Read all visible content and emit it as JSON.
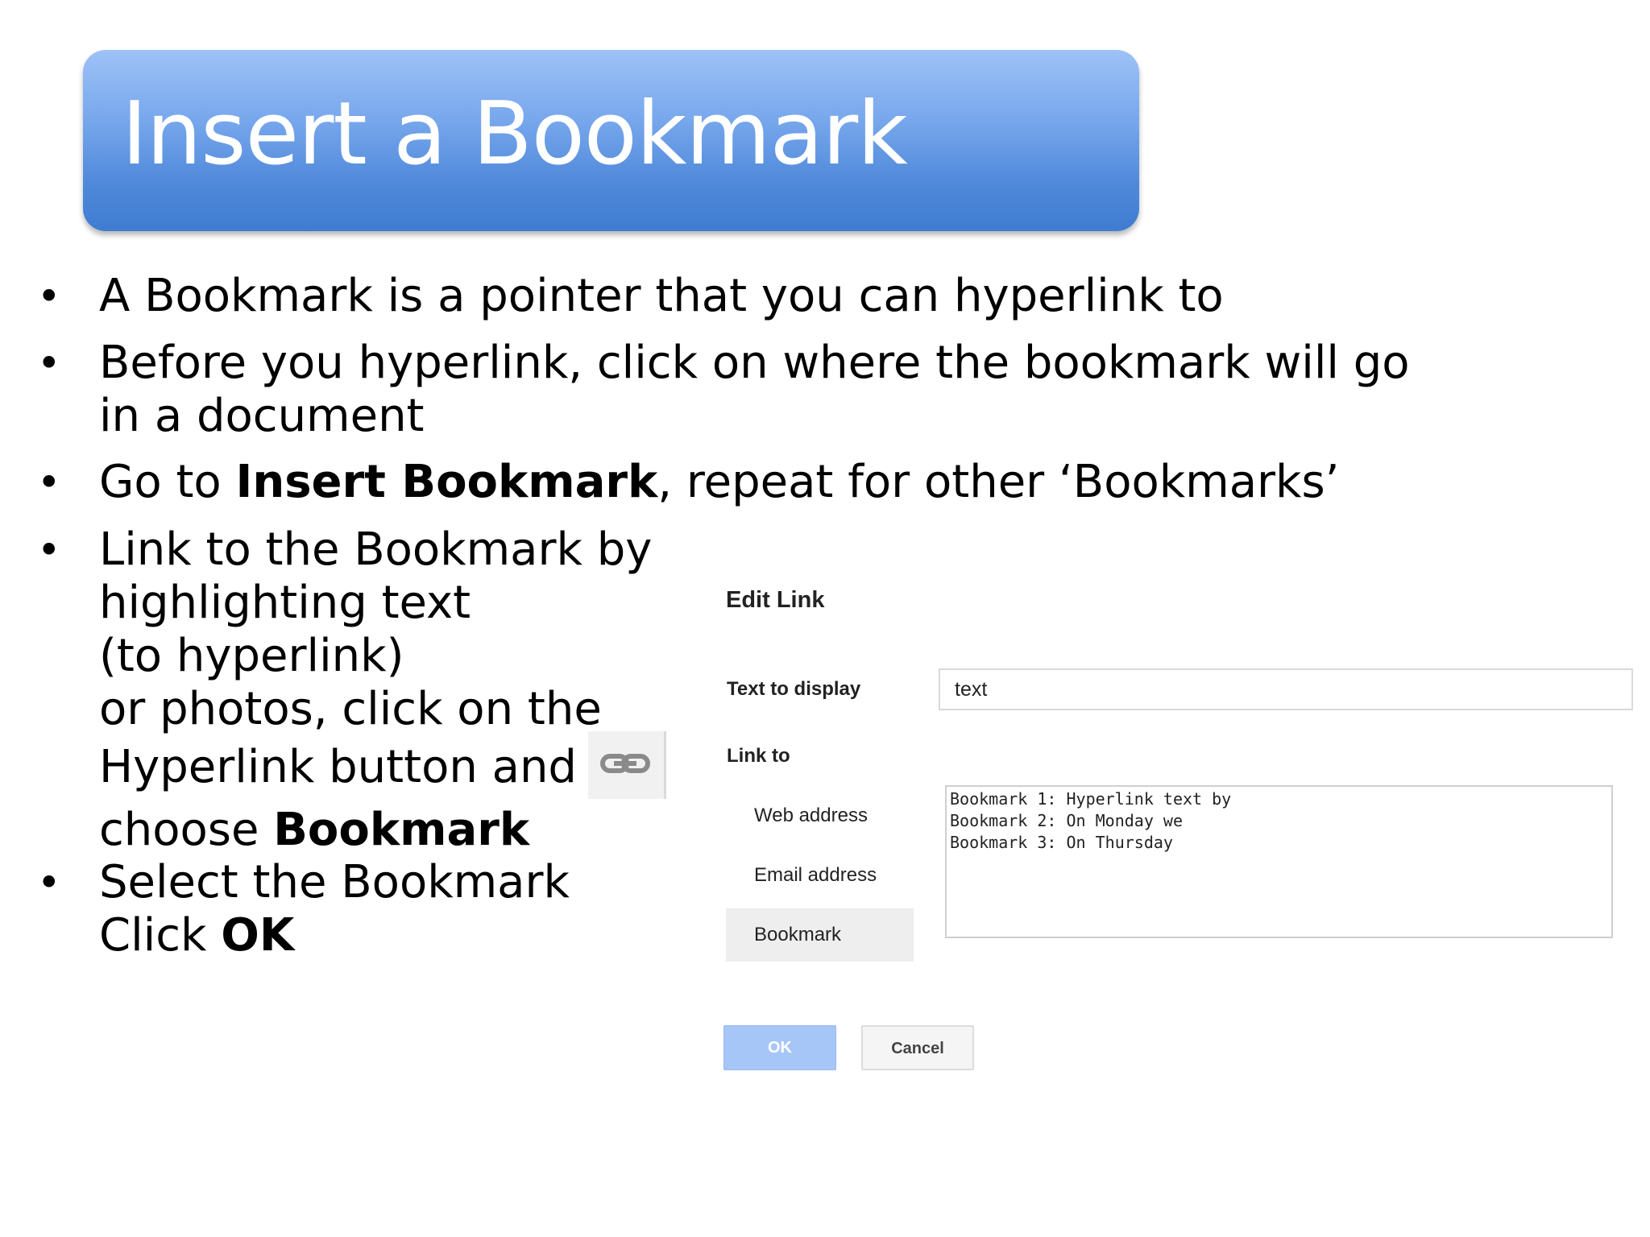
{
  "slide": {
    "title": "Insert a Bookmark",
    "bullet_char": "•",
    "bullets": {
      "b1": "A Bookmark is a pointer that you can hyperlink to",
      "b2_line1": "Before you hyperlink, click on where the bookmark will go",
      "b2_line2": "in a document",
      "b3_pre": "Go to ",
      "b3_bold": "Insert Bookmark",
      "b3_post": ", repeat for other ‘Bookmarks’",
      "b4_line1": "Link to the Bookmark by",
      "b4_line2": "highlighting text",
      "b4_line3": "(to hyperlink)",
      "b4_line4": "or photos, click on the",
      "b4_line5": "Hyperlink button and",
      "b4_line6_pre": "choose ",
      "b4_line6_bold": "Bookmark",
      "b5_line1": "Select the Bookmark",
      "b5_line2_pre": "Click ",
      "b5_line2_bold": "OK"
    }
  },
  "dialog": {
    "title": "Edit Link",
    "text_to_display_label": "Text to display",
    "text_to_display_value": "text",
    "link_to_label": "Link to",
    "options": [
      "Web address",
      "Email address",
      "Bookmark"
    ],
    "selected_option": "Bookmark",
    "bookmarks": [
      "Bookmark 1: Hyperlink text by",
      "Bookmark 2: On Monday we",
      "Bookmark 3: On Thursday"
    ],
    "ok_label": "OK",
    "cancel_label": "Cancel"
  },
  "colors": {
    "title_gradient_top": "#9ec2f7",
    "title_gradient_bottom": "#3f7cd1",
    "ok_button": "#a7c6f8"
  },
  "icons": {
    "hyperlink_button": "link-chain-icon"
  }
}
